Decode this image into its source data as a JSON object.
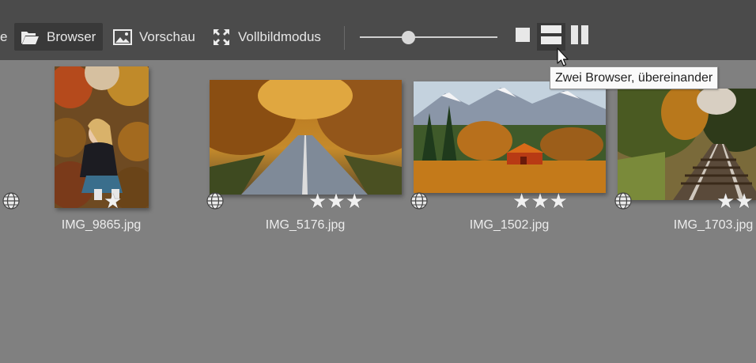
{
  "toolbar": {
    "cut_label": "e",
    "browser_label": "Browser",
    "preview_label": "Vorschau",
    "fullscreen_label": "Vollbildmodus",
    "thumbnail_size_slider_value": 0.34
  },
  "tooltip": {
    "text": "Zwei Browser, übereinander"
  },
  "thumbnails": [
    {
      "filename": "IMG_9865.jpg",
      "stars": 1,
      "geotagged": true
    },
    {
      "filename": "IMG_5176.jpg",
      "stars": 3,
      "geotagged": true
    },
    {
      "filename": "IMG_1502.jpg",
      "stars": 3,
      "geotagged": true
    },
    {
      "filename": "IMG_1703.jpg",
      "stars": 2,
      "geotagged": true
    }
  ],
  "icons": {
    "browser": "folder-open-icon",
    "preview": "image-icon",
    "fullscreen": "expand-arrows-icon",
    "single_view": "square-icon",
    "two_stacked": "two-rows-icon",
    "two_side_by_side": "two-columns-icon",
    "geo": "globe-icon",
    "rating": "star-icon"
  },
  "colors": {
    "toolbar_bg": "#4b4b4b",
    "content_bg": "#808080",
    "active_bg": "#393939",
    "text": "#e6e6e6"
  }
}
